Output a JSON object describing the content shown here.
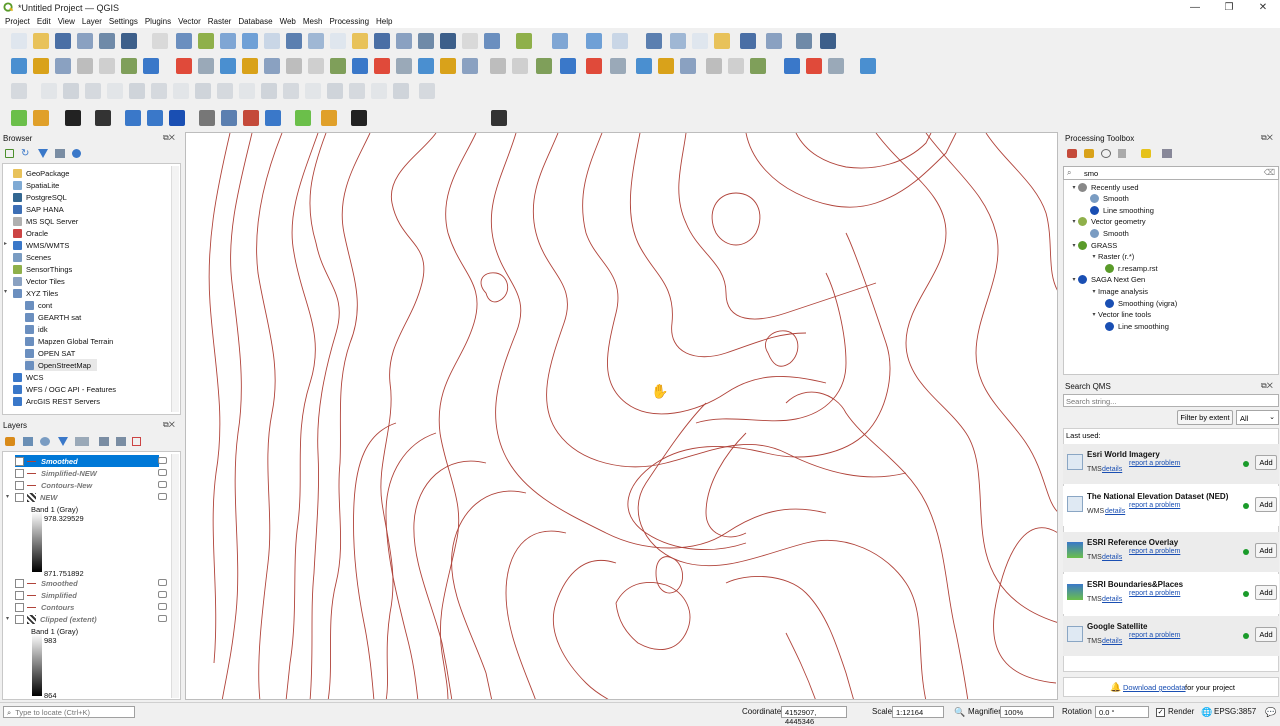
{
  "window": {
    "title": "*Untitled Project — QGIS",
    "controls": [
      "—",
      "❐",
      "✕"
    ]
  },
  "menu": [
    "Project",
    "Edit",
    "View",
    "Layer",
    "Settings",
    "Plugins",
    "Vector",
    "Raster",
    "Database",
    "Web",
    "Mesh",
    "Processing",
    "Help"
  ],
  "colors": {
    "contour": "#b0433a",
    "selection": "#0078d7",
    "accent": "#1a4fb3",
    "status_ok": "#1a9b2a"
  },
  "browser": {
    "title": "Browser",
    "items": [
      {
        "label": "GeoPackage",
        "icon": "geopackage-icon"
      },
      {
        "label": "SpatiaLite",
        "icon": "spatialite-icon"
      },
      {
        "label": "PostgreSQL",
        "icon": "postgresql-icon"
      },
      {
        "label": "SAP HANA",
        "icon": "saphana-icon"
      },
      {
        "label": "MS SQL Server",
        "icon": "mssql-icon"
      },
      {
        "label": "Oracle",
        "icon": "oracle-icon"
      },
      {
        "label": "WMS/WMTS",
        "icon": "wms-icon"
      },
      {
        "label": "Scenes",
        "icon": "scenes-icon"
      },
      {
        "label": "SensorThings",
        "icon": "sensorthings-icon"
      },
      {
        "label": "Vector Tiles",
        "icon": "vectortiles-icon"
      },
      {
        "label": "XYZ Tiles",
        "icon": "xyz-icon"
      },
      {
        "label": "cont",
        "icon": "tile-icon"
      },
      {
        "label": "GEARTH sat",
        "icon": "tile-icon"
      },
      {
        "label": "idk",
        "icon": "tile-icon"
      },
      {
        "label": "Mapzen Global Terrain",
        "icon": "tile-icon"
      },
      {
        "label": "OPEN SAT",
        "icon": "tile-icon"
      },
      {
        "label": "OpenStreetMap",
        "icon": "tile-icon"
      },
      {
        "label": "WCS",
        "icon": "wcs-icon"
      },
      {
        "label": "WFS / OGC API - Features",
        "icon": "wfs-icon"
      },
      {
        "label": "ArcGIS REST Servers",
        "icon": "arcgis-icon"
      }
    ]
  },
  "layers": {
    "title": "Layers",
    "items": [
      {
        "label": "Smoothed",
        "checked": true,
        "selected": true
      },
      {
        "label": "Simplified-NEW",
        "checked": false
      },
      {
        "label": "Contours-New",
        "checked": false
      },
      {
        "label": "NEW",
        "checked": false,
        "raster": true
      },
      {
        "label": "Band 1 (Gray)"
      },
      {
        "label": "978.329529"
      },
      {
        "label": "871.751892"
      },
      {
        "label": "Smoothed",
        "checked": false
      },
      {
        "label": "Simplified",
        "checked": false
      },
      {
        "label": "Contours",
        "checked": false
      },
      {
        "label": "Clipped (extent)",
        "checked": false,
        "raster": true
      },
      {
        "label": "Band 1 (Gray)"
      },
      {
        "label": "983"
      },
      {
        "label": "864"
      }
    ]
  },
  "processing": {
    "title": "Processing Toolbox",
    "search_value": "smo",
    "tree": [
      {
        "label": "Recently used",
        "level": 0,
        "icon": "clock-icon"
      },
      {
        "label": "Smooth",
        "level": 1,
        "icon": "gear-icon"
      },
      {
        "label": "Line smoothing",
        "level": 1,
        "icon": "saga-icon"
      },
      {
        "label": "Vector geometry",
        "level": 0,
        "icon": "qgis-icon"
      },
      {
        "label": "Smooth",
        "level": 1,
        "icon": "gear-icon"
      },
      {
        "label": "GRASS",
        "level": 0,
        "icon": "grass-icon"
      },
      {
        "label": "Raster (r.*)",
        "level": 1,
        "icon": ""
      },
      {
        "label": "r.resamp.rst",
        "level": 2,
        "icon": "grass-icon"
      },
      {
        "label": "SAGA Next Gen",
        "level": 0,
        "icon": "saga-icon"
      },
      {
        "label": "Image analysis",
        "level": 1,
        "icon": ""
      },
      {
        "label": "Smoothing (vigra)",
        "level": 2,
        "icon": "saga-icon"
      },
      {
        "label": "Vector line tools",
        "level": 1,
        "icon": ""
      },
      {
        "label": "Line smoothing",
        "level": 2,
        "icon": "saga-icon"
      }
    ]
  },
  "qms": {
    "title": "Search QMS",
    "search_placeholder": "Search string...",
    "filter_label": "Filter by extent",
    "filter_value": "All",
    "last_used": "Last used:",
    "items": [
      {
        "name": "Esri World Imagery",
        "type": "TMS",
        "details": "details",
        "report": "report a problem"
      },
      {
        "name": "The National Elevation Dataset (NED)",
        "type": "WMS",
        "details": "details",
        "report": "report a problem"
      },
      {
        "name": "ESRI Reference Overlay",
        "type": "TMS",
        "details": "details",
        "report": "report a problem"
      },
      {
        "name": "ESRI Boundaries&Places",
        "type": "TMS",
        "details": "details",
        "report": "report a problem"
      },
      {
        "name": "Google Satellite",
        "type": "TMS",
        "details": "details",
        "report": "report a problem"
      }
    ],
    "add_label": "Add",
    "download_link": "Download geodata",
    "download_suffix": " for your project"
  },
  "status": {
    "locate_placeholder": "Type to locate (Ctrl+K)",
    "coordinate_label": "Coordinate",
    "coordinate_value": "4152907, 4445346",
    "scale_label": "Scale",
    "scale_value": "1:12164",
    "magnifier_label": "Magnifier",
    "magnifier_value": "100%",
    "rotation_label": "Rotation",
    "rotation_value": "0.0 °",
    "render_label": "Render",
    "crs_label": "EPSG:3857"
  }
}
